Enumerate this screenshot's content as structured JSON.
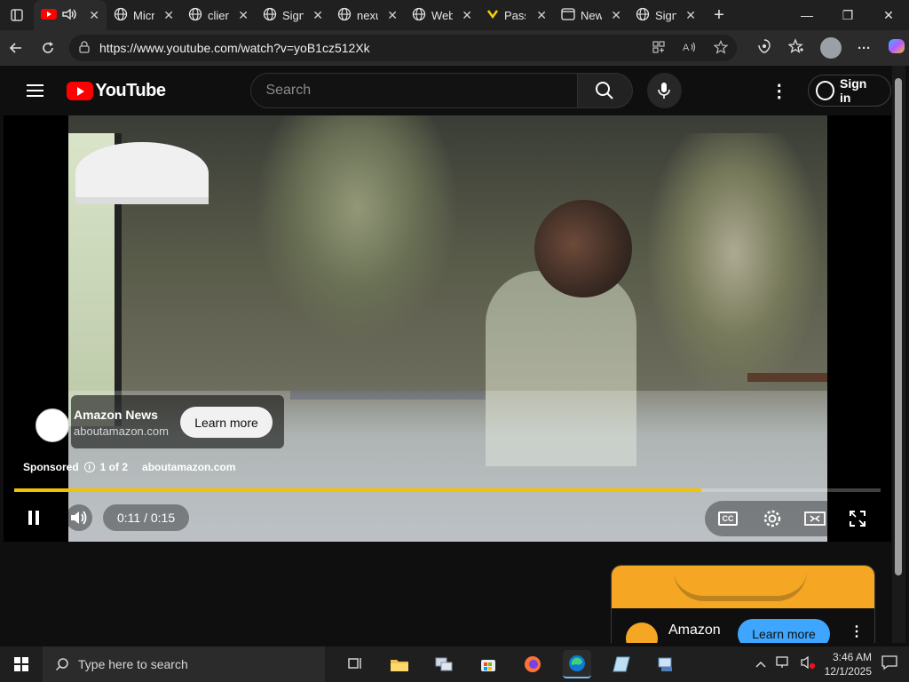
{
  "browser": {
    "tabs": [
      {
        "title": "",
        "has_audio": true,
        "icon": "youtube-icon",
        "active": true
      },
      {
        "title": "Micr",
        "icon": "globe-icon",
        "active": false
      },
      {
        "title": "clien",
        "icon": "globe-icon",
        "active": false
      },
      {
        "title": "Sign",
        "icon": "globe-icon",
        "active": false
      },
      {
        "title": "nexu",
        "icon": "globe-icon",
        "active": false
      },
      {
        "title": "Web",
        "icon": "globe-icon",
        "active": false
      },
      {
        "title": "Pass",
        "icon": "yellow-logo-icon",
        "active": false
      },
      {
        "title": "New",
        "icon": "newtab-icon",
        "active": false
      },
      {
        "title": "Sign",
        "icon": "globe-icon",
        "active": false
      }
    ],
    "address": {
      "url": "https://www.youtube.com/watch?v=yoB1cz512Xk"
    },
    "window_controls": {
      "minimize": "—",
      "maximize": "❐",
      "close": "✕"
    }
  },
  "youtube": {
    "brand": "YouTube",
    "search": {
      "placeholder": "Search"
    },
    "sign_in": "Sign in",
    "ad": {
      "advertiser": "Amazon News",
      "domain": "aboutamazon.com",
      "cta": "Learn more",
      "sponsored": "Sponsored",
      "info_icon": "i",
      "count": "1 of 2",
      "sponsored_domain": "aboutamazon.com"
    },
    "player": {
      "time": "0:11 / 0:15",
      "progress_fraction": 0.793
    },
    "companion_card": {
      "name": "Amazon",
      "cta": "Learn more"
    }
  },
  "taskbar": {
    "search_placeholder": "Type here to search",
    "time": "3:46 AM",
    "date": "12/1/2025"
  }
}
